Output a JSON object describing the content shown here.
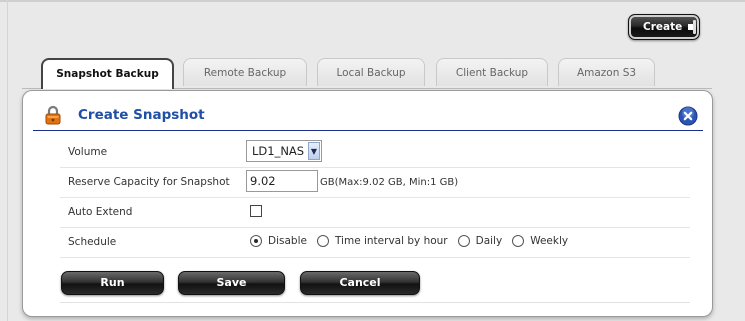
{
  "header": {
    "create_label": "Create"
  },
  "tabs": [
    {
      "label": "Snapshot Backup",
      "active": true
    },
    {
      "label": "Remote Backup",
      "active": false
    },
    {
      "label": "Local Backup",
      "active": false
    },
    {
      "label": "Client Backup",
      "active": false
    },
    {
      "label": "Amazon S3",
      "active": false
    }
  ],
  "panel": {
    "title": "Create Snapshot",
    "icons": {
      "title": "lock-icon",
      "close": "close-icon"
    },
    "colors": {
      "title": "#1f4fa6",
      "close": "#2a55b5"
    },
    "fields": {
      "volume": {
        "label": "Volume",
        "value": "LD1_NAS"
      },
      "reserve": {
        "label": "Reserve Capacity for Snapshot",
        "value": "9.02",
        "hint": "GB(Max:9.02 GB, Min:1 GB)"
      },
      "auto_extend": {
        "label": "Auto Extend",
        "checked": false
      },
      "schedule": {
        "label": "Schedule",
        "options": [
          "Disable",
          "Time interval by hour",
          "Daily",
          "Weekly"
        ],
        "selected": "Disable"
      }
    },
    "buttons": {
      "run": "Run",
      "save": "Save",
      "cancel": "Cancel"
    }
  }
}
